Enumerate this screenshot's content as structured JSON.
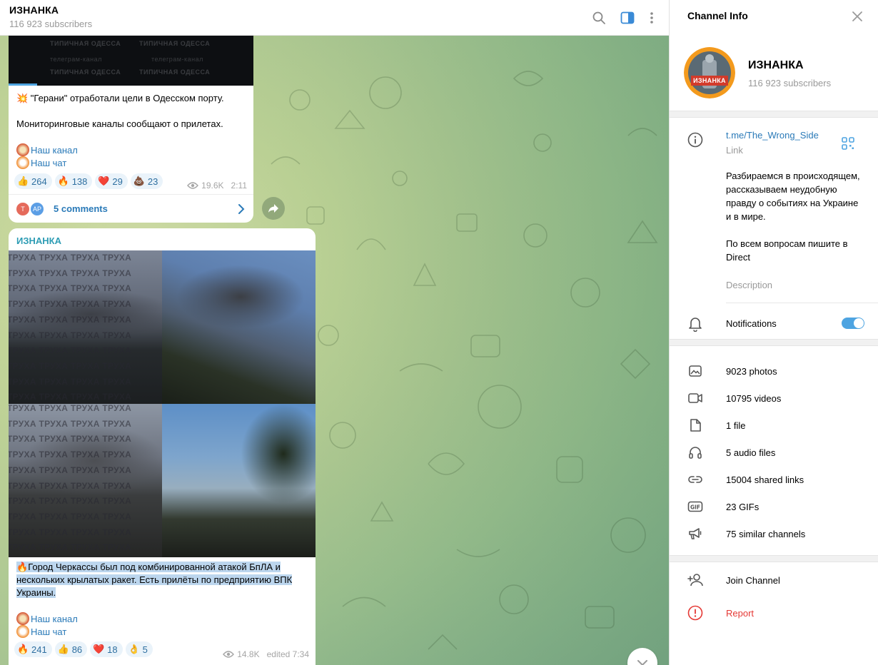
{
  "chat": {
    "title": "ИЗНАНКА",
    "subscribers": "116 923 subscribers"
  },
  "message1": {
    "watermark_lines": [
      "ТИПИЧНАЯ ОДЕССА",
      "телеграм-канал",
      "ТИПИЧНАЯ ОДЕССА"
    ],
    "text1": "💥 \"Герани\" отработали цели в Одесском порту.",
    "text2": "Мониторинговые каналы сообщают о прилетах.",
    "link1": "Наш канал",
    "link2": "Наш чат",
    "reactions": [
      {
        "emoji": "👍",
        "count": "264"
      },
      {
        "emoji": "🔥",
        "count": "138"
      },
      {
        "emoji": "❤️",
        "count": "29"
      },
      {
        "emoji": "💩",
        "count": "23"
      }
    ],
    "views": "19.6K",
    "time": "2:11",
    "commenter_initials": [
      "T",
      "AP"
    ],
    "comments": "5 comments"
  },
  "message2": {
    "author": "ИЗНАНКА",
    "watermark": "ТРУХА ТРУХА ТРУХА ТРУХА",
    "text_emoji": "🔥",
    "text": "Город Черкассы был под комбинированной атакой БпЛА и нескольких крылатых ракет. Есть прилёты по предприятию ВПК Украины.",
    "link1": "Наш канал",
    "link2": "Наш чат",
    "reactions": [
      {
        "emoji": "🔥",
        "count": "241"
      },
      {
        "emoji": "👍",
        "count": "86"
      },
      {
        "emoji": "❤️",
        "count": "18"
      },
      {
        "emoji": "👌",
        "count": "5"
      }
    ],
    "views": "14.8K",
    "time": "edited 7:34"
  },
  "panel": {
    "title": "Channel Info",
    "channel_name": "ИЗНАНКА",
    "subscribers": "116 923 subscribers",
    "avatar_text": "ИЗНАНКА",
    "link": "t.me/The_Wrong_Side",
    "link_label": "Link",
    "description": "Разбираемся в происходящем, рассказываем неудобную правду о событиях на Украине и в мире.\n\nПо всем вопросам пишите в Direct",
    "description_label": "Description",
    "notifications": "Notifications",
    "notifications_on": true,
    "media": [
      {
        "icon": "photo-icon",
        "label": "9023 photos"
      },
      {
        "icon": "video-icon",
        "label": "10795 videos"
      },
      {
        "icon": "file-icon",
        "label": "1 file"
      },
      {
        "icon": "headphones-icon",
        "label": "5 audio files"
      },
      {
        "icon": "link-icon",
        "label": "15004 shared links"
      },
      {
        "icon": "gif-icon",
        "label": "23 GIFs"
      },
      {
        "icon": "megaphone-icon",
        "label": "75 similar channels"
      }
    ],
    "join": "Join Channel",
    "report": "Report"
  },
  "colors": {
    "accent": "#2a7ab8",
    "author": "#2d9cb4",
    "toggle": "#4ea4e1",
    "report": "#e53935",
    "selection": "#bcd6ee"
  }
}
